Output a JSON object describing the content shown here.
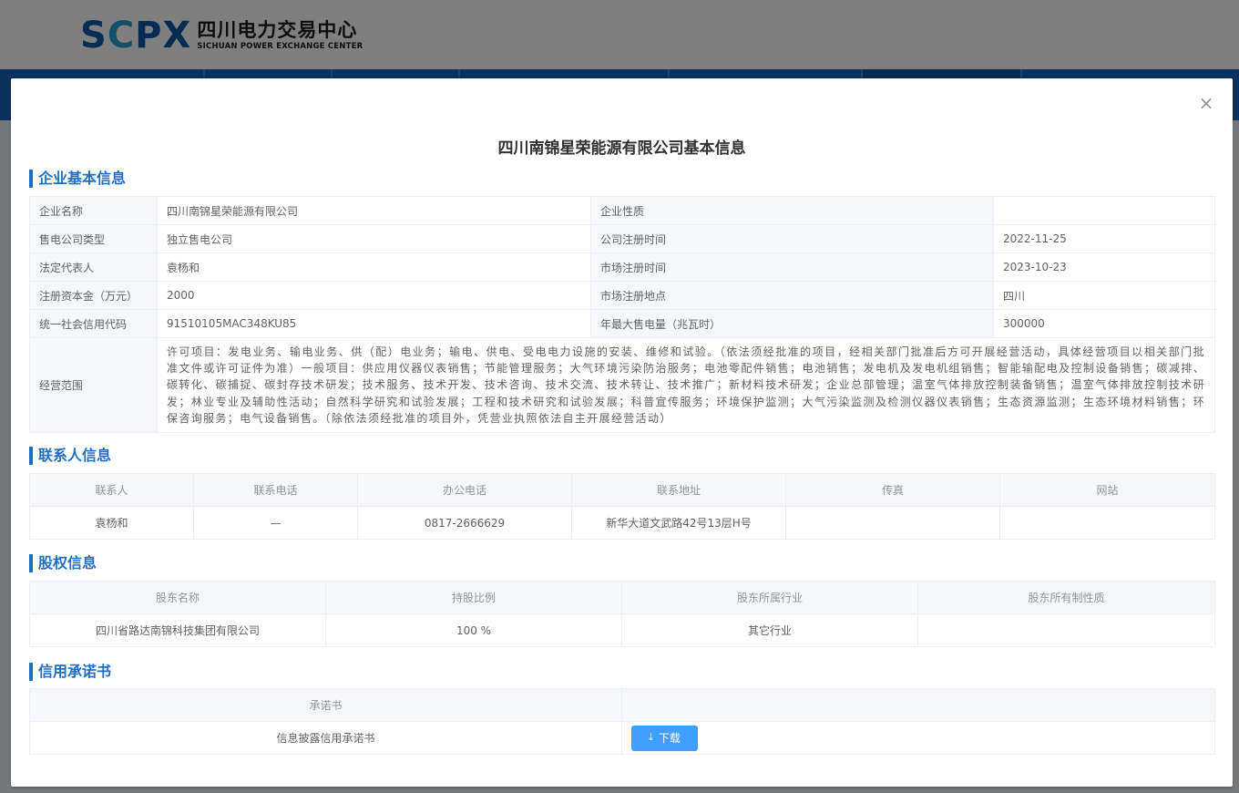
{
  "background": {
    "logo_mark": "SCPX",
    "logo_cn": "四川电力交易中心",
    "logo_en": "SICHUAN POWER EXCHANGE CENTER"
  },
  "dialog": {
    "title": "四川南锦星荣能源有限公司基本信息",
    "close_icon": "close-icon"
  },
  "basic_info": {
    "section_title": "企业基本信息",
    "rows": [
      {
        "label1": "企业名称",
        "value1": "四川南锦星荣能源有限公司",
        "label2": "企业性质",
        "value2": ""
      },
      {
        "label1": "售电公司类型",
        "value1": "独立售电公司",
        "label2": "公司注册时间",
        "value2": "2022-11-25"
      },
      {
        "label1": "法定代表人",
        "value1": "袁杨和",
        "label2": "市场注册时间",
        "value2": "2023-10-23"
      },
      {
        "label1": "注册资本金（万元）",
        "value1": "2000",
        "label2": "市场注册地点",
        "value2": "四川"
      },
      {
        "label1": "统一社会信用代码",
        "value1": "91510105MAC348KU85",
        "label2": "年最大售电量（兆瓦时）",
        "value2": "300000"
      }
    ],
    "scope_label": "经营范围",
    "scope_value": "许可项目：发电业务、输电业务、供（配）电业务；输电、供电、受电电力设施的安装、维修和试验。（依法须经批准的项目，经相关部门批准后方可开展经营活动，具体经营项目以相关部门批准文件或许可证件为准）一般项目：供应用仪器仪表销售；节能管理服务；大气环境污染防治服务；电池零配件销售；电池销售；发电机及发电机组销售；智能输配电及控制设备销售；碳减排、碳转化、碳捕捉、碳封存技术研发；技术服务、技术开发、技术咨询、技术交流、技术转让、技术推广；新材料技术研发；企业总部管理；温室气体排放控制装备销售；温室气体排放控制技术研发；林业专业及辅助性活动；自然科学研究和试验发展；工程和技术研究和试验发展；科普宣传服务；环境保护监测；大气污染监测及检测仪器仪表销售；生态资源监测；生态环境材料销售；环保咨询服务；电气设备销售。（除依法须经批准的项目外，凭营业执照依法自主开展经营活动）"
  },
  "contacts": {
    "section_title": "联系人信息",
    "columns": [
      "联系人",
      "联系电话",
      "办公电话",
      "联系地址",
      "传真",
      "网站"
    ],
    "rows": [
      [
        "袁杨和",
        "—",
        "0817-2666629",
        "新华大道文武路42号13层H号",
        "",
        ""
      ]
    ]
  },
  "equity": {
    "section_title": "股权信息",
    "columns": [
      "股东名称",
      "持股比例",
      "股东所属行业",
      "股东所有制性质"
    ],
    "rows": [
      [
        "四川省路达南锦科技集团有限公司",
        "100 %",
        "其它行业",
        ""
      ]
    ]
  },
  "credit": {
    "section_title": "信用承诺书",
    "columns": [
      "承诺书",
      ""
    ],
    "rows": [
      {
        "name": "信息披露信用承诺书",
        "button_label": "下载",
        "button_icon": "download-icon"
      }
    ]
  },
  "colors": {
    "accent": "#1f6fc5",
    "button": "#409eff",
    "nav": "#1565c0"
  }
}
